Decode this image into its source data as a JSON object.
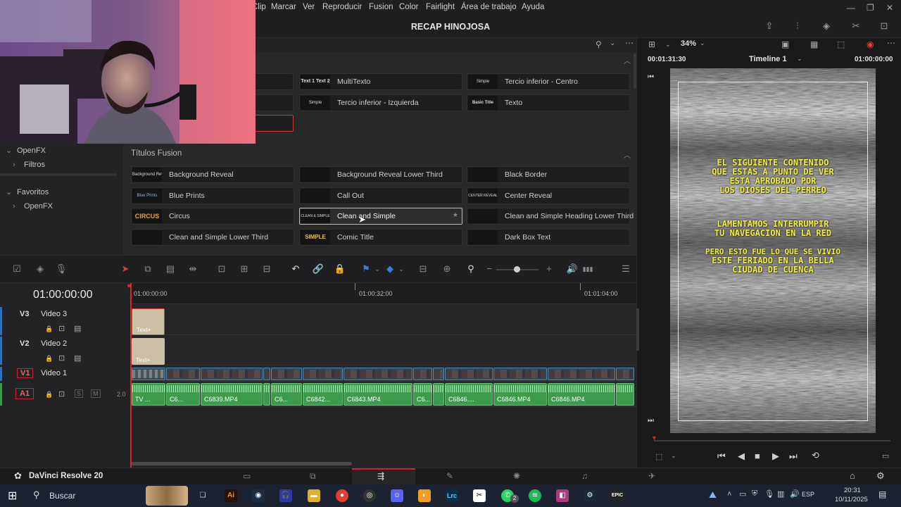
{
  "menu": [
    "Clip",
    "Marcar",
    "Ver",
    "Reproducir",
    "Fusion",
    "Color",
    "Fairlight",
    "Área de trabajo",
    "Ayuda"
  ],
  "project_title": "RECAP HINOJOSA",
  "sidebar": {
    "items": [
      {
        "label": "OpenFX",
        "caret": "⌄"
      },
      {
        "label": "Filtros",
        "caret": "›"
      },
      {
        "label": "Favoritos",
        "caret": "⌄"
      },
      {
        "label": "OpenFX",
        "caret": "›"
      }
    ]
  },
  "effects": {
    "titles_top": [
      {
        "label": "MultiTexto",
        "thumb": "Text 1 Text 2"
      },
      {
        "label": "Tercio inferior - Centro",
        "thumb": "Simple"
      },
      {
        "label": "Tercio inferior - Izquierda",
        "thumb": "Simple"
      },
      {
        "label": "Texto",
        "thumb": "Basic Title"
      }
    ],
    "section_title": "Títulos Fusion",
    "fusion_titles": [
      {
        "label": "Background Reveal",
        "thumb": "Background Reveal"
      },
      {
        "label": "Background Reveal Lower Third",
        "thumb": ""
      },
      {
        "label": "Black Border",
        "thumb": ""
      },
      {
        "label": "Blue Prints",
        "thumb": "Blue Prints"
      },
      {
        "label": "Call Out",
        "thumb": ""
      },
      {
        "label": "Center Reveal",
        "thumb": "CENTER REVEAL"
      },
      {
        "label": "Circus",
        "thumb": "CIRCUS"
      },
      {
        "label": "Clean and Simple",
        "thumb": "CLEAN & SIMPLE"
      },
      {
        "label": "Clean and Simple Heading Lower Third",
        "thumb": ""
      },
      {
        "label": "Clean and Simple Lower Third",
        "thumb": ""
      },
      {
        "label": "Comic Title",
        "thumb": "SIMPLE"
      },
      {
        "label": "Dark Box Text",
        "thumb": ""
      }
    ]
  },
  "viewer": {
    "zoom": "34%",
    "source_tc": "00:01:31:30",
    "timeline_name": "Timeline 1",
    "record_tc": "01:00:00:00",
    "overlay_text": [
      "EL SIGUIENTE CONTENIDO",
      "QUE ESTAS A PUNTO DE VER",
      "ESTA APROBADO POR",
      "LOS DIOSES DEL PERREO",
      "LAMENTAMOS INTERRUMPIR",
      "TU NAVEGACION EN LA RED",
      "PERO ESTO FUE LO QUE SE VIVIO",
      "ESTE FERIADO EN LA BELLA",
      "CIUDAD DE CUENCA"
    ]
  },
  "timeline": {
    "timecode": "01:00:00:00",
    "ruler": [
      "01:00:00:00",
      "01:00:32:00",
      "01:01:04:00"
    ],
    "tracks": [
      {
        "id": "V3",
        "name": "Video 3"
      },
      {
        "id": "V2",
        "name": "Video 2"
      },
      {
        "id": "V1",
        "name": "Video 1"
      },
      {
        "id": "A1",
        "name": "",
        "level": "2.0",
        "solo": "S",
        "mute": "M"
      }
    ],
    "text_clip_label": "Text+",
    "audio_clips": [
      "TV ...",
      "C6...",
      "C6839.MP4",
      "C6...",
      "C6842...",
      "C6843.MP4",
      "C6...",
      "C6846....",
      "C6846.MP4",
      "C6846.MP4"
    ]
  },
  "app_name": "DaVinci Resolve 20",
  "taskbar": {
    "search_placeholder": "Buscar",
    "time": "20:31",
    "date": "10/11/2025",
    "lang": "ESP",
    "badge": "2"
  }
}
